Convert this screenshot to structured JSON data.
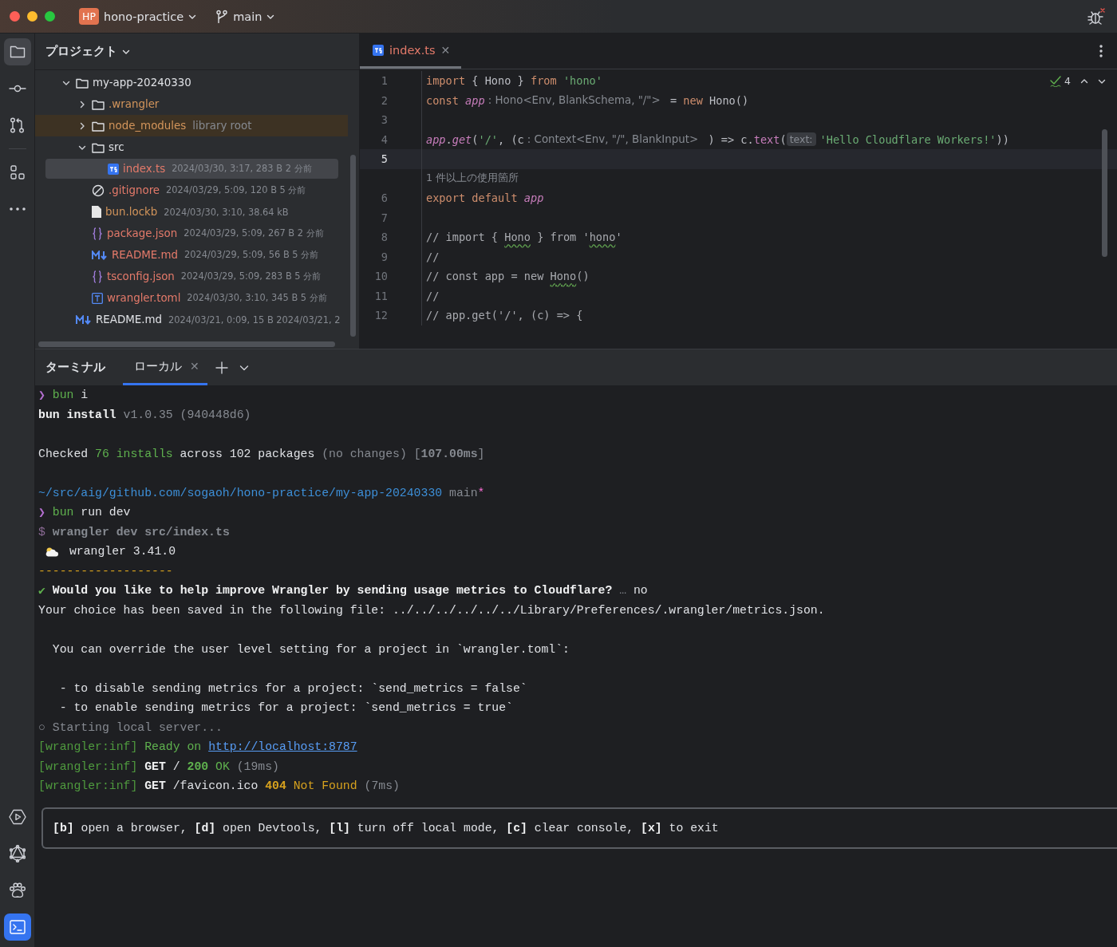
{
  "title_bar": {
    "project_badge": "HP",
    "project": "hono-practice",
    "branch": "main"
  },
  "project_panel": {
    "title": "プロジェクト",
    "tree": [
      {
        "name": "my-app-20240330",
        "kind": "folder",
        "color": "#dfe1e5",
        "selected": false,
        "excluded": false,
        "expanded": true,
        "children": [
          {
            "name": ".wrangler",
            "kind": "folder",
            "color": "#d3955b",
            "selected": false,
            "excluded": false,
            "expanded": false
          },
          {
            "name": "node_modules",
            "meta": "library root",
            "kind": "folder",
            "color": "#d3955b",
            "selected": false,
            "excluded": true,
            "expanded": false
          },
          {
            "name": "src",
            "kind": "folder",
            "color": "#dfe1e5",
            "selected": false,
            "excluded": false,
            "expanded": true,
            "children": [
              {
                "name": "index.ts",
                "meta": "2024/03/30, 3:17, 283 B 2 分前",
                "kind": "ts",
                "color": "#e47a6a",
                "selected": true,
                "excluded": false
              }
            ]
          },
          {
            "name": ".gitignore",
            "meta": "2024/03/29, 5:09, 120 B 5 分前",
            "kind": "ignore",
            "color": "#e47a6a",
            "selected": false,
            "excluded": false
          },
          {
            "name": "bun.lockb",
            "meta": "2024/03/30, 3:10, 38.64 kB",
            "kind": "file",
            "color": "#d3955b",
            "selected": false,
            "excluded": false
          },
          {
            "name": "package.json",
            "meta": "2024/03/29, 5:09, 267 B 2 分前",
            "kind": "json",
            "color": "#e47a6a",
            "selected": false,
            "excluded": false
          },
          {
            "name": "README.md",
            "meta": "2024/03/29, 5:09, 56 B 5 分前",
            "kind": "md",
            "color": "#e47a6a",
            "selected": false,
            "excluded": false
          },
          {
            "name": "tsconfig.json",
            "meta": "2024/03/29, 5:09, 283 B 5 分前",
            "kind": "json",
            "color": "#e47a6a",
            "selected": false,
            "excluded": false
          },
          {
            "name": "wrangler.toml",
            "meta": "2024/03/30, 3:10, 345 B 5 分前",
            "kind": "toml",
            "color": "#e47a6a",
            "selected": false,
            "excluded": false
          }
        ]
      },
      {
        "name": "README.md",
        "meta": "2024/03/21, 0:09, 15 B 2024/03/21, 2",
        "kind": "md",
        "color": "#dfe1e5",
        "selected": false,
        "excluded": false
      }
    ]
  },
  "editor": {
    "tabs": [
      {
        "label": "index.ts",
        "close": "✕",
        "selected": true
      }
    ],
    "problems": "4",
    "lines": [
      {
        "kind": "code",
        "number": "1",
        "current": false,
        "segments": [
          {
            "kind": "kw",
            "t": "import"
          },
          {
            "kind": "plain",
            "t": " { Hono } "
          },
          {
            "kind": "kw",
            "t": "from"
          },
          {
            "kind": "str",
            "t": " 'hono'"
          }
        ]
      },
      {
        "kind": "code",
        "number": "2",
        "current": false,
        "segments": [
          {
            "kind": "kw",
            "t": "const"
          },
          {
            "kind": "ident",
            "t": " app"
          },
          {
            "kind": "hint",
            "t": ": Hono<Env, BlankSchema, \"/\">"
          },
          {
            "kind": "plain",
            "t": " = "
          },
          {
            "kind": "kw",
            "t": "new"
          },
          {
            "kind": "plain",
            "t": " Hono()"
          }
        ]
      },
      {
        "kind": "code",
        "number": "3",
        "current": false
      },
      {
        "kind": "code",
        "number": "4",
        "current": false,
        "segments": [
          {
            "kind": "ident",
            "t": "app"
          },
          {
            "kind": "plain",
            "t": "."
          },
          {
            "kind": "ident",
            "t": "get"
          },
          {
            "kind": "plain",
            "t": "("
          },
          {
            "kind": "str",
            "t": "'/'"
          },
          {
            "kind": "plain",
            "t": ", (c"
          },
          {
            "kind": "hint",
            "t": ": Context<Env, \"/\", BlankInput>"
          },
          {
            "kind": "plain",
            "t": " ) => c."
          },
          {
            "kind": "method",
            "t": "text"
          },
          {
            "kind": "plain",
            "t": "("
          },
          {
            "kind": "badge",
            "t": "text:"
          },
          {
            "kind": "str",
            "t": "'Hello Cloudflare Workers!'"
          },
          {
            "kind": "plain",
            "t": "))"
          }
        ]
      },
      {
        "kind": "code",
        "number": "5",
        "current": true
      },
      {
        "kind": "usages",
        "text": "1 件以上の使用箇所"
      },
      {
        "kind": "code",
        "number": "6",
        "current": false,
        "segments": [
          {
            "kind": "kw",
            "t": "export default"
          },
          {
            "kind": "ident",
            "t": " app"
          }
        ]
      },
      {
        "kind": "code",
        "number": "7",
        "current": false
      },
      {
        "kind": "code",
        "number": "8",
        "current": false,
        "segments": [
          {
            "kind": "comment",
            "t": "// import { "
          },
          {
            "kind": "typo",
            "t": "Hono"
          },
          {
            "kind": "comment",
            "t": " } from '"
          },
          {
            "kind": "typo",
            "t": "hono"
          },
          {
            "kind": "comment",
            "t": "'"
          }
        ]
      },
      {
        "kind": "code",
        "number": "9",
        "current": false,
        "segments": [
          {
            "kind": "comment",
            "t": "//"
          }
        ]
      },
      {
        "kind": "code",
        "number": "10",
        "current": false,
        "segments": [
          {
            "kind": "comment",
            "t": "// const app = new "
          },
          {
            "kind": "typo",
            "t": "Hono"
          },
          {
            "kind": "comment",
            "t": "()"
          }
        ]
      },
      {
        "kind": "code",
        "number": "11",
        "current": false,
        "segments": [
          {
            "kind": "comment",
            "t": "//"
          }
        ]
      },
      {
        "kind": "code",
        "number": "12",
        "current": false,
        "segments": [
          {
            "kind": "comment",
            "t": "// app.get('/', (c) => {"
          }
        ]
      }
    ]
  },
  "terminal": {
    "title": "ターミナル",
    "tabs": [
      {
        "label": "ローカル",
        "close": "✕",
        "selected": true
      }
    ],
    "lines": [
      {
        "kind": "text",
        "segments": [
          {
            "kind": "purple",
            "t": "❯ "
          },
          {
            "kind": "green",
            "t": "bun"
          },
          {
            "kind": "plain",
            "t": " i"
          }
        ]
      },
      {
        "kind": "text",
        "segments": [
          {
            "kind": "bold",
            "t": "bun install"
          },
          {
            "kind": "dim",
            "t": " v1.0.35 (940448d6)"
          }
        ]
      },
      {
        "kind": "blank"
      },
      {
        "kind": "text",
        "segments": [
          {
            "kind": "plain",
            "t": "Checked "
          },
          {
            "kind": "green",
            "t": "76 installs"
          },
          {
            "kind": "plain",
            "t": " across 102 packages "
          },
          {
            "kind": "dim",
            "t": "(no changes) ["
          },
          {
            "kind": "dimbold",
            "t": "107.00ms"
          },
          {
            "kind": "dim",
            "t": "]"
          }
        ]
      },
      {
        "kind": "blank"
      },
      {
        "kind": "text",
        "segments": [
          {
            "kind": "blue",
            "t": "~/src/aig/github.com/sogaoh/hono-practice/my-app-20240330"
          },
          {
            "kind": "dim",
            "t": " main"
          },
          {
            "kind": "pink",
            "t": "*"
          }
        ]
      },
      {
        "kind": "text",
        "segments": [
          {
            "kind": "purple",
            "t": "❯ "
          },
          {
            "kind": "green",
            "t": "bun"
          },
          {
            "kind": "plain",
            "t": " run dev"
          }
        ]
      },
      {
        "kind": "text",
        "segments": [
          {
            "kind": "dimpurple",
            "t": "$ "
          },
          {
            "kind": "dimbold",
            "t": "wrangler dev src/index.ts"
          }
        ]
      },
      {
        "kind": "text",
        "segments": [
          {
            "kind": "cloud"
          },
          {
            "kind": "plain",
            "t": " wrangler 3.41.0"
          }
        ]
      },
      {
        "kind": "text",
        "segments": [
          {
            "kind": "yellow",
            "t": "-------------------"
          }
        ]
      },
      {
        "kind": "text",
        "segments": [
          {
            "kind": "green",
            "t": "✔ "
          },
          {
            "kind": "bold",
            "t": "Would you like to help improve Wrangler by sending usage metrics to Cloudflare?"
          },
          {
            "kind": "dim",
            "t": " …"
          },
          {
            "kind": "plain",
            "t": " no"
          }
        ]
      },
      {
        "kind": "text",
        "segments": [
          {
            "kind": "plain",
            "t": "Your choice has been saved in the following file: ../../../../../../Library/Preferences/.wrangler/metrics.json."
          }
        ]
      },
      {
        "kind": "blank"
      },
      {
        "kind": "text",
        "segments": [
          {
            "kind": "plain",
            "t": "  You can override the user level setting for a project in `wrangler.toml`:"
          }
        ]
      },
      {
        "kind": "blank"
      },
      {
        "kind": "text",
        "segments": [
          {
            "kind": "plain",
            "t": "   - to disable sending metrics for a project: `send_metrics = false`"
          }
        ]
      },
      {
        "kind": "text",
        "segments": [
          {
            "kind": "plain",
            "t": "   - to enable sending metrics for a project: `send_metrics = true`"
          }
        ]
      },
      {
        "kind": "text",
        "segments": [
          {
            "kind": "dim",
            "t": "○ Starting local server..."
          }
        ]
      },
      {
        "kind": "text",
        "segments": [
          {
            "kind": "dimgreen",
            "t": "[wrangler:inf]"
          },
          {
            "kind": "green",
            "t": " Ready on "
          },
          {
            "kind": "link",
            "t": "http://localhost:8787"
          }
        ]
      },
      {
        "kind": "text",
        "segments": [
          {
            "kind": "dimgreen",
            "t": "[wrangler:inf]"
          },
          {
            "kind": "bold",
            "t": " GET"
          },
          {
            "kind": "plain",
            "t": " / "
          },
          {
            "kind": "greenbold",
            "t": "200"
          },
          {
            "kind": "green",
            "t": " OK"
          },
          {
            "kind": "dim",
            "t": " (19ms)"
          }
        ]
      },
      {
        "kind": "text",
        "segments": [
          {
            "kind": "dimgreen",
            "t": "[wrangler:inf]"
          },
          {
            "kind": "bold",
            "t": " GET"
          },
          {
            "kind": "plain",
            "t": " /favicon.ico "
          },
          {
            "kind": "yellowbold",
            "t": "404"
          },
          {
            "kind": "yellow",
            "t": " Not Found"
          },
          {
            "kind": "dim",
            "t": " (7ms)"
          }
        ]
      }
    ],
    "hotkeys": [
      {
        "kind": "bold",
        "t": "[b]"
      },
      {
        "kind": "plain",
        "t": " open a browser, "
      },
      {
        "kind": "bold",
        "t": "[d]"
      },
      {
        "kind": "plain",
        "t": " open Devtools, "
      },
      {
        "kind": "bold",
        "t": "[l]"
      },
      {
        "kind": "plain",
        "t": " turn off local mode, "
      },
      {
        "kind": "bold",
        "t": "[c]"
      },
      {
        "kind": "plain",
        "t": " clear console, "
      },
      {
        "kind": "bold",
        "t": "[x]"
      },
      {
        "kind": "plain",
        "t": " to exit"
      }
    ]
  }
}
